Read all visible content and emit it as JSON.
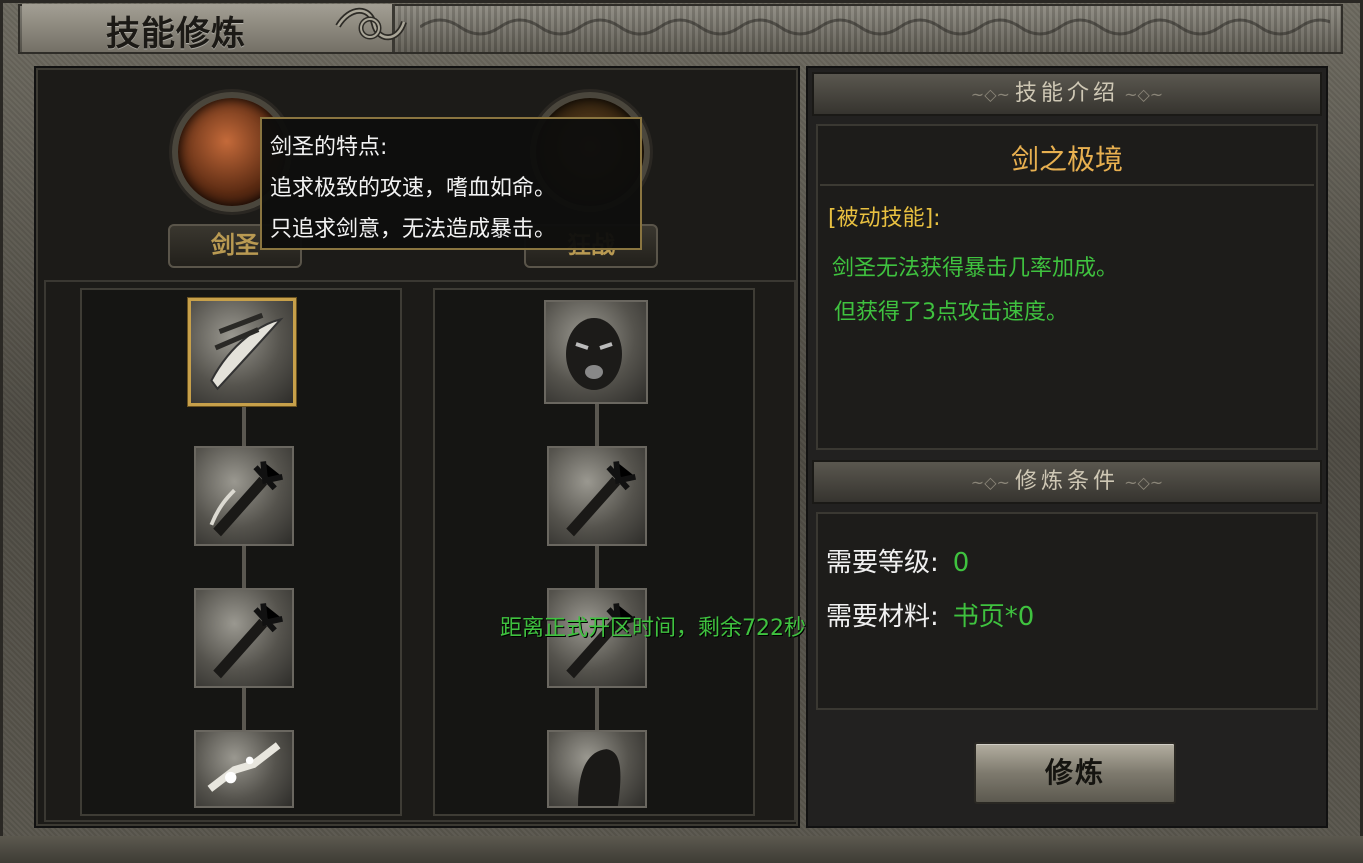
{
  "window": {
    "title": "技能修炼"
  },
  "portraits": [
    {
      "name": "剑圣"
    },
    {
      "name": "狂战"
    }
  ],
  "tooltip": {
    "lines": [
      "剑圣的特点:",
      "追求极致的攻速，嗜血如命。",
      "只追求剑意，无法造成暴击。"
    ]
  },
  "skill_tree": {
    "left_column": [
      "swift-blade-icon",
      "sword-icon",
      "sword-icon",
      "sword-shatter-icon"
    ],
    "right_column": [
      "berserker-face-icon",
      "sword-icon",
      "sword-icon",
      "hooded-figure-icon"
    ],
    "selected": "swift-blade-icon"
  },
  "notice": "距离正式开区时间，剩余722秒!",
  "skill_intro": {
    "header": "技能介绍",
    "name": "剑之极境",
    "type": "[被动技能]:",
    "description": [
      "剑圣无法获得暴击几率加成。",
      "但获得了3点攻击速度。"
    ]
  },
  "requirements": {
    "header": "修炼条件",
    "level_label": "需要等级:",
    "level_value": "0",
    "material_label": "需要材料:",
    "material_value": "书页*0"
  },
  "train_button": "修炼",
  "colors": {
    "accent_gold": "#e8b050",
    "description_green": "#3fc23f",
    "type_yellow": "#e8c040",
    "selected_border": "#c7a04a"
  }
}
